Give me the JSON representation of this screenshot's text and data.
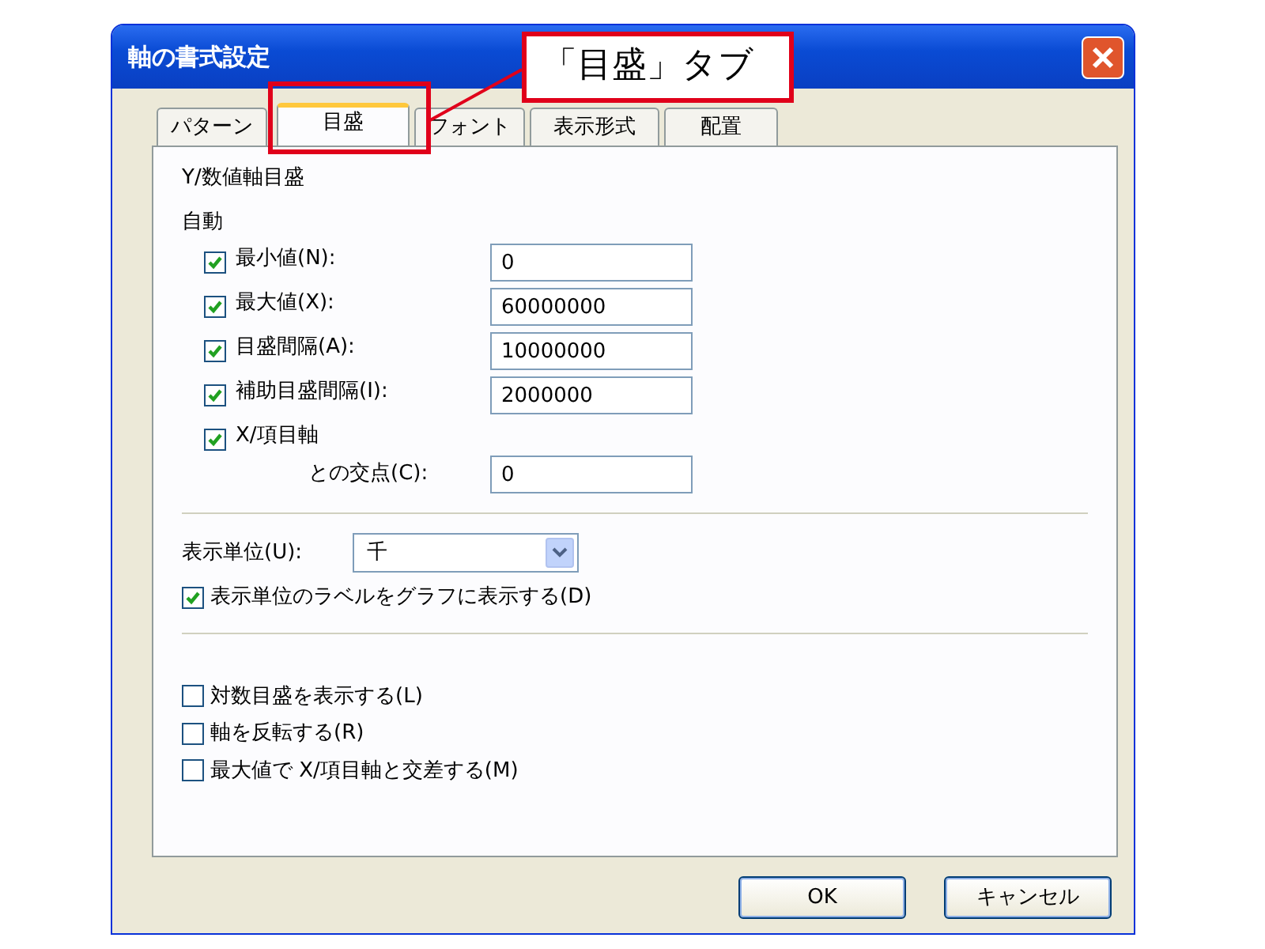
{
  "window": {
    "title": "軸の書式設定"
  },
  "callout": {
    "text": "「目盛」タブ"
  },
  "tabs": [
    {
      "label": "パターン",
      "selected": false
    },
    {
      "label": "目盛",
      "selected": true
    },
    {
      "label": "フォント",
      "selected": false
    },
    {
      "label": "表示形式",
      "selected": false
    },
    {
      "label": "配置",
      "selected": false
    }
  ],
  "section_title": "Y/数値軸目盛",
  "auto_label": "自動",
  "auto_fields": [
    {
      "label": "最小値(N):",
      "checked": true,
      "value": "0"
    },
    {
      "label": "最大値(X):",
      "checked": true,
      "value": "60000000"
    },
    {
      "label": "目盛間隔(A):",
      "checked": true,
      "value": "10000000"
    },
    {
      "label": "補助目盛間隔(I):",
      "checked": true,
      "value": "2000000"
    },
    {
      "label": "X/項目軸",
      "sublabel": "との交点(C):",
      "checked": true,
      "value": "0"
    }
  ],
  "display_unit": {
    "label": "表示単位(U):",
    "value": "千"
  },
  "show_unit_label": {
    "label": "表示単位のラベルをグラフに表示する(D)",
    "checked": true
  },
  "options": [
    {
      "label": "対数目盛を表示する(L)",
      "checked": false
    },
    {
      "label": "軸を反転する(R)",
      "checked": false
    },
    {
      "label": "最大値で X/項目軸と交差する(M)",
      "checked": false
    }
  ],
  "buttons": [
    {
      "label": "OK"
    },
    {
      "label": "キャンセル"
    }
  ]
}
